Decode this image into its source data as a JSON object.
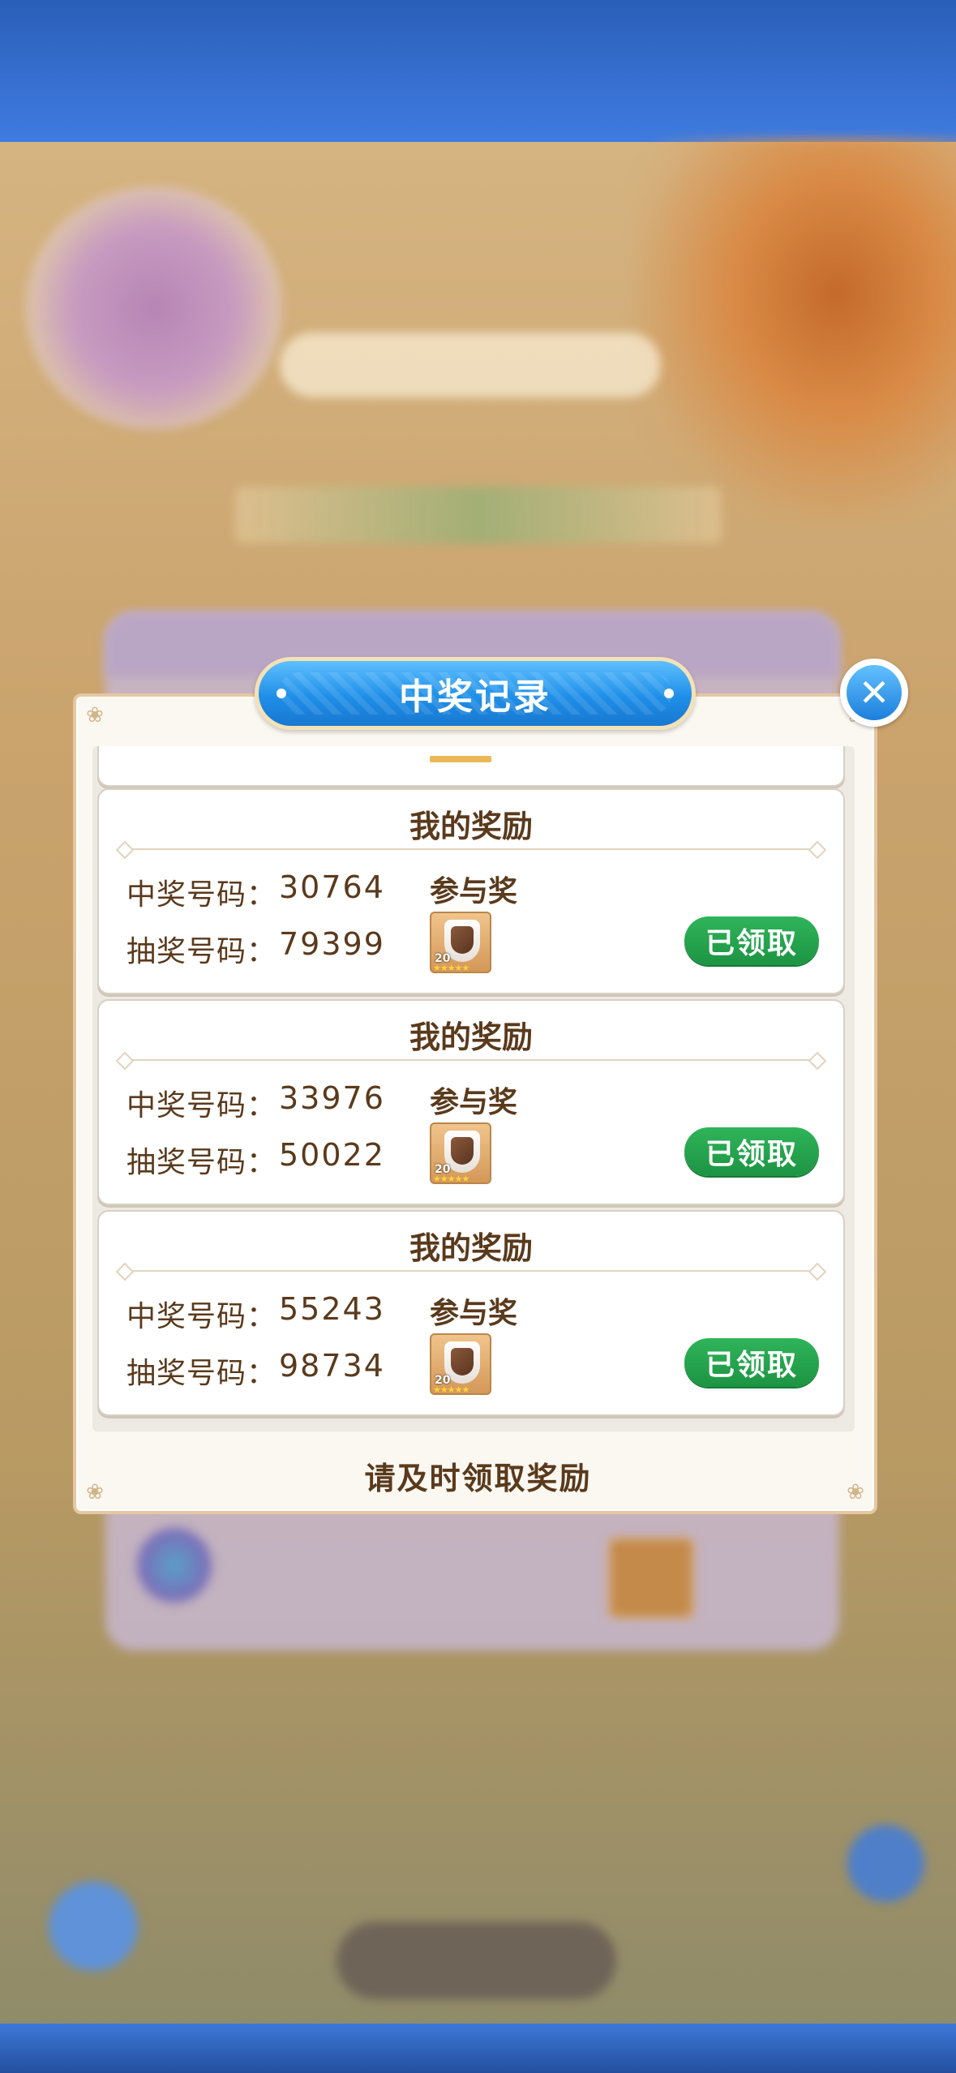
{
  "modal": {
    "title": "中奖记录",
    "footer_note": "请及时领取奖励",
    "close_icon": "close-icon"
  },
  "records": [
    {
      "header": "我的奖励",
      "win_label": "中奖号码：",
      "win_number": "30764",
      "draw_label": "抽奖号码：",
      "draw_number": "79399",
      "prize": "参与奖",
      "item_level": "20",
      "status": "已领取"
    },
    {
      "header": "我的奖励",
      "win_label": "中奖号码：",
      "win_number": "33976",
      "draw_label": "抽奖号码：",
      "draw_number": "50022",
      "prize": "参与奖",
      "item_level": "20",
      "status": "已领取"
    },
    {
      "header": "我的奖励",
      "win_label": "中奖号码：",
      "win_number": "55243",
      "draw_label": "抽奖号码：",
      "draw_number": "98734",
      "prize": "参与奖",
      "item_level": "20",
      "status": "已领取"
    }
  ],
  "colors": {
    "accent_blue": "#1f8fe8",
    "claimed_green": "#1d9443",
    "text_brown": "#5a3a1c"
  }
}
